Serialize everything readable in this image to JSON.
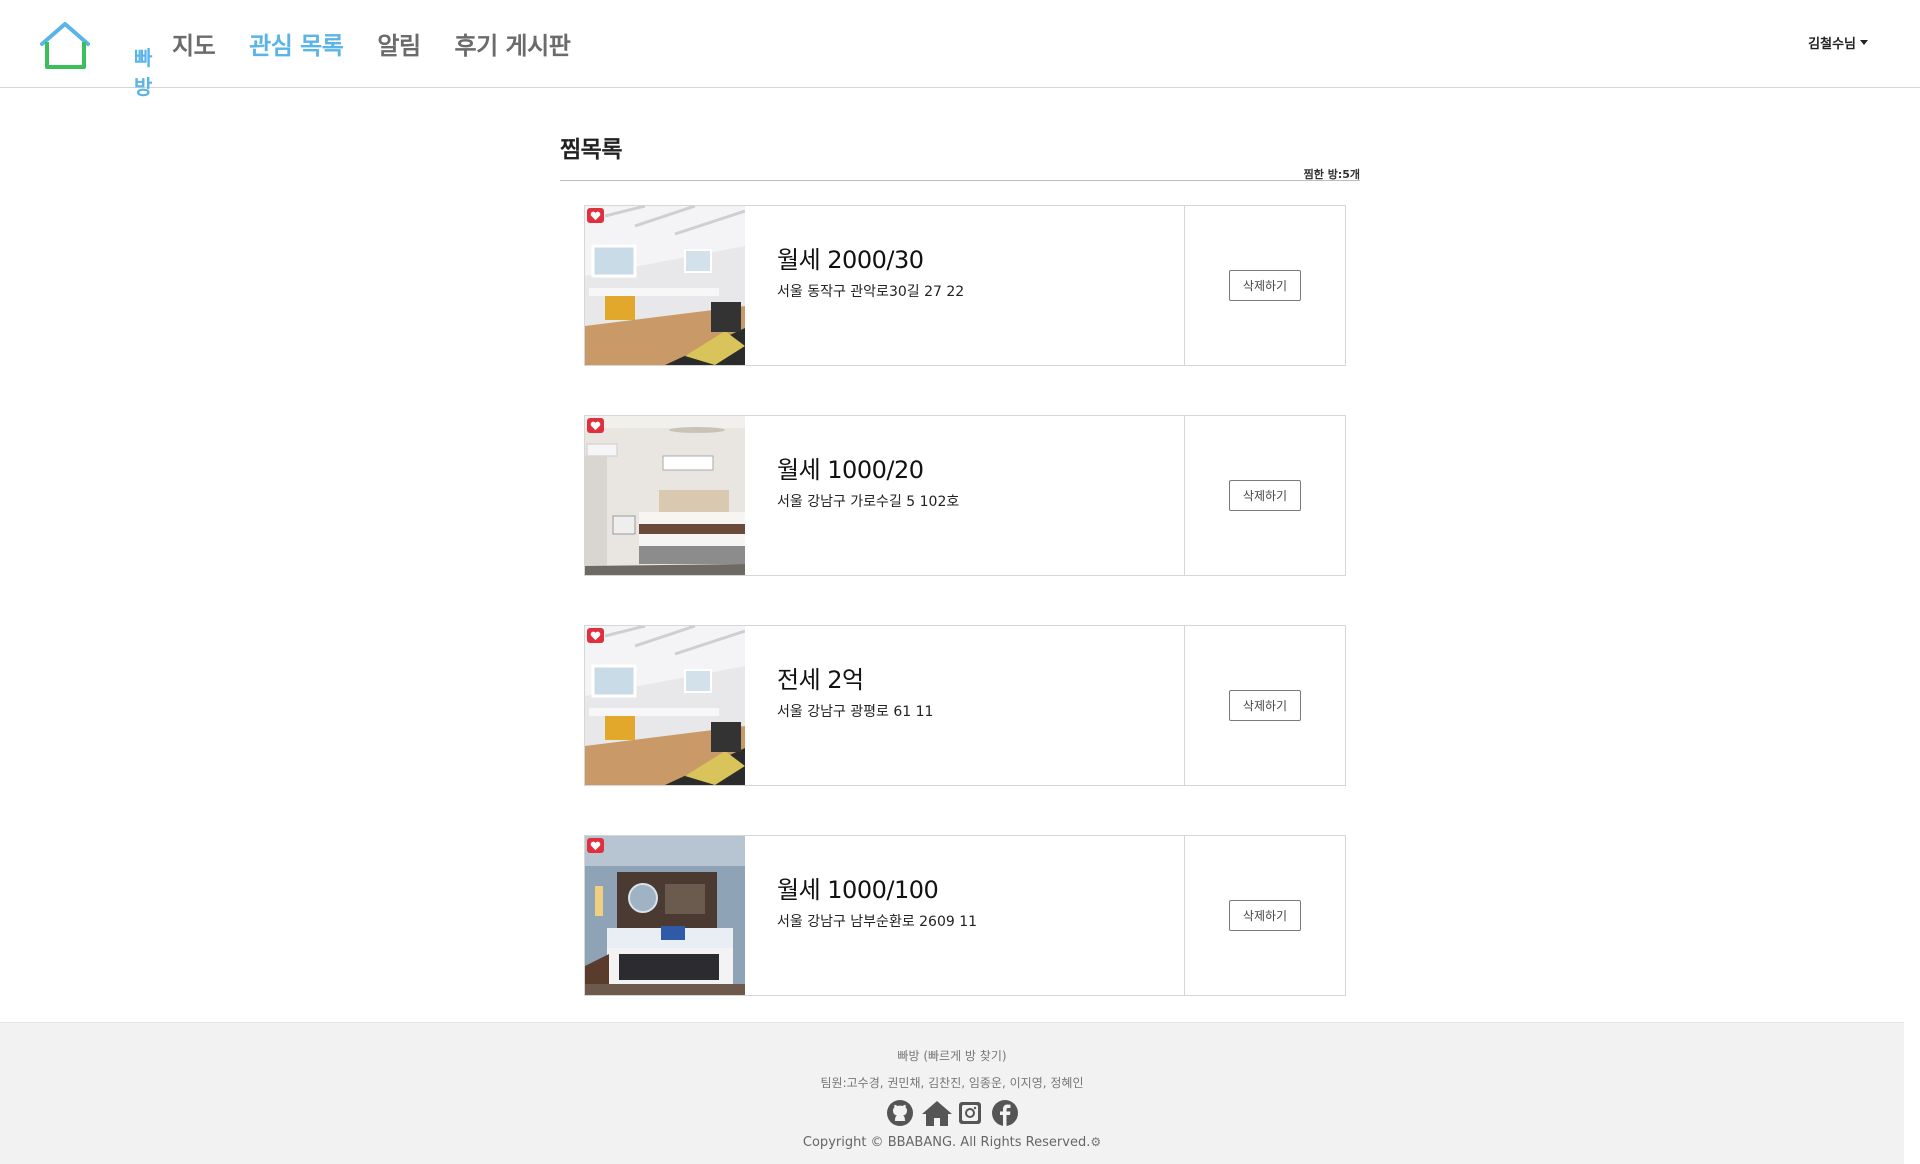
{
  "header": {
    "logo_text": "빠방",
    "nav": [
      "지도",
      "관심 목록",
      "알림",
      "후기 게시판"
    ],
    "active_nav": "관심 목록",
    "user": "김철수님"
  },
  "main": {
    "title": "찜목록",
    "count_text": "찜한 방:5개",
    "delete_label": "삭제하기",
    "items": [
      {
        "price": "월세 2000/30",
        "address": "서울 동작구 관악로30길 27 22",
        "image": "attic-room"
      },
      {
        "price": "월세 1000/20",
        "address": "서울 강남구 가로수길 5 102호",
        "image": "bedroom-fan"
      },
      {
        "price": "전세 2억",
        "address": "서울 강남구 광평로 61 11",
        "image": "attic-room"
      },
      {
        "price": "월세 1000/100",
        "address": "서울 강남구 남부순환로 2609 11",
        "image": "hotel-room"
      }
    ]
  },
  "footer": {
    "line1": "빠방 (빠르게 방 찾기)",
    "line2": "팀원:고수경, 권민채, 김찬진, 임종운, 이지영, 정혜인",
    "icons": [
      "github-icon",
      "home-icon",
      "instagram-icon",
      "facebook-icon"
    ],
    "copyright": "Copyright © BBABANG. All Rights Reserved."
  },
  "colors": {
    "accent": "#5ab4e8",
    "logo_green": "#3bbf5a",
    "heart": "#e0303e",
    "footer_bg": "#f2f2f2"
  }
}
